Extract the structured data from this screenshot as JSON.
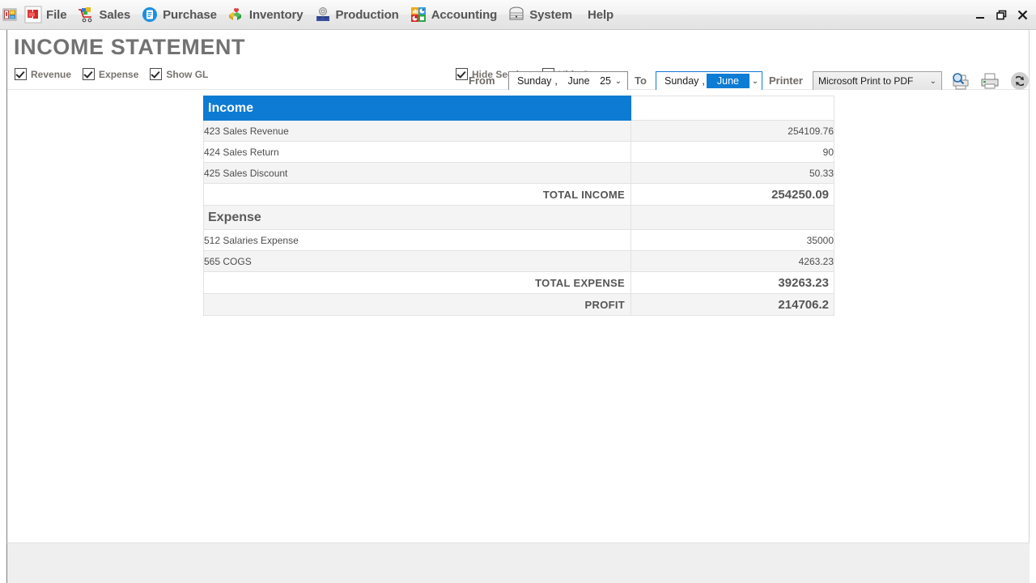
{
  "window": {
    "app_icon": "app-window-icon",
    "controls": {
      "minimize": "–",
      "restore": "❐",
      "close": "✕"
    }
  },
  "menubar": {
    "items": [
      {
        "label": "File",
        "icon": "file-puzzle-icon"
      },
      {
        "label": "Sales",
        "icon": "shopping-cart-icon"
      },
      {
        "label": "Purchase",
        "icon": "purchase-document-icon"
      },
      {
        "label": "Inventory",
        "icon": "inventory-boxes-icon"
      },
      {
        "label": "Production",
        "icon": "production-machine-icon"
      },
      {
        "label": "Accounting",
        "icon": "accounting-charts-icon"
      },
      {
        "label": "System",
        "icon": "system-server-icon"
      },
      {
        "label": "Help",
        "icon": ""
      }
    ]
  },
  "header": {
    "title": "INCOME STATEMENT",
    "options_left": [
      {
        "label": "Revenue",
        "checked": true
      },
      {
        "label": "Expense",
        "checked": true
      },
      {
        "label": "Show GL",
        "checked": true
      }
    ],
    "options_center": [
      {
        "label": "Hide Section",
        "checked": true
      },
      {
        "label": "Hide Category",
        "checked": true
      }
    ],
    "from_label": "From",
    "to_label": "To",
    "printer_label": "Printer",
    "date_from": {
      "weekday": "Sunday",
      "comma": ",",
      "month": "June",
      "day": "25",
      "arrow": "⌄"
    },
    "date_to": {
      "weekday": "Sunday",
      "comma": ",",
      "month": "June",
      "arrow": "⌄"
    },
    "printer_value": "Microsoft Print to PDF",
    "printer_arrow": "⌄",
    "toolbar_icons": [
      {
        "name": "print-preview-icon"
      },
      {
        "name": "print-icon"
      },
      {
        "name": "refresh-icon"
      }
    ]
  },
  "report": {
    "rows": [
      {
        "type": "section",
        "name": "Income",
        "value": "",
        "shade": false
      },
      {
        "type": "item",
        "name": "423 Sales Revenue",
        "value": "254109.76",
        "shade": true
      },
      {
        "type": "item",
        "name": "424 Sales Return",
        "value": "90",
        "shade": false
      },
      {
        "type": "item",
        "name": "425 Sales Discount",
        "value": "50.33",
        "shade": true
      },
      {
        "type": "total",
        "name": "TOTAL INCOME",
        "value": "254250.09",
        "shade": false
      },
      {
        "type": "subsection",
        "name": "Expense",
        "value": "",
        "shade": true
      },
      {
        "type": "item",
        "name": "512 Salaries Expense",
        "value": "35000",
        "shade": false
      },
      {
        "type": "item",
        "name": "565 COGS",
        "value": "4263.23",
        "shade": true
      },
      {
        "type": "total",
        "name": "TOTAL EXPENSE",
        "value": "39263.23",
        "shade": false
      },
      {
        "type": "total",
        "name": "PROFIT",
        "value": "214706.2",
        "shade": true
      }
    ]
  },
  "statusbar": {
    "text": ""
  },
  "colors": {
    "accent_blue": "#0d7bd4",
    "title_gray": "#737272",
    "label_brown": "#77736e",
    "row_shade": "#f4f4f4"
  }
}
